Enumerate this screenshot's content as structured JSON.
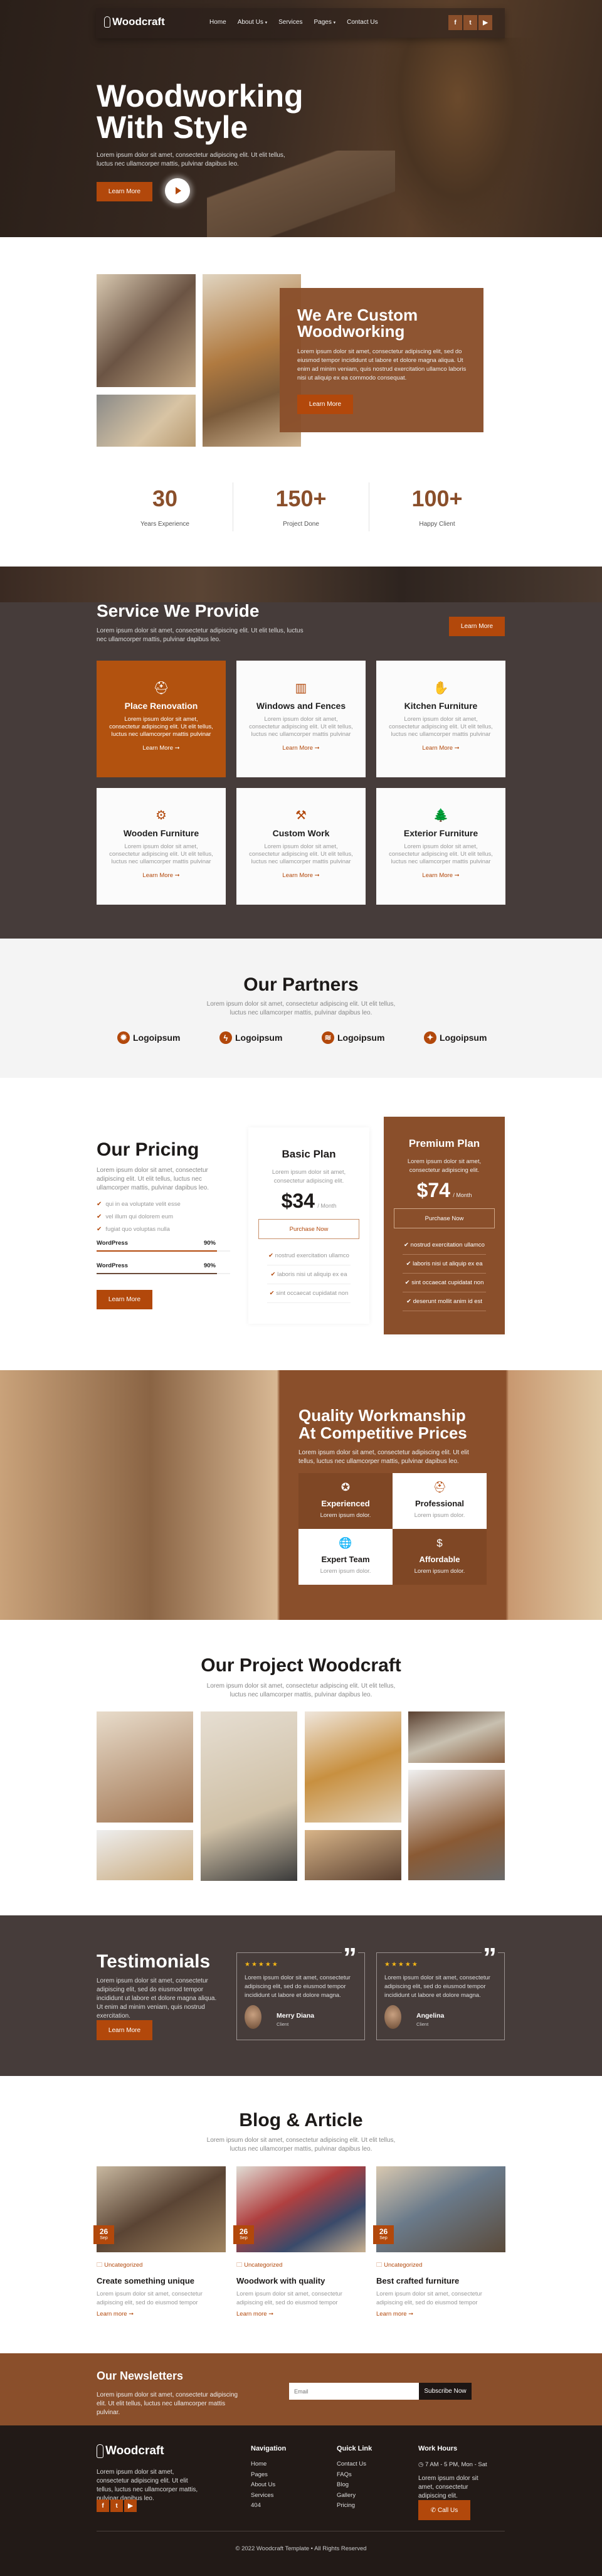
{
  "brand": {
    "name": "Woodcraft",
    "primary": "#b2480b",
    "brown": "#8a4f2b",
    "dark": "#463c3a",
    "footer": "#221a17"
  },
  "nav": {
    "items": [
      {
        "label": "Home"
      },
      {
        "label": "About Us",
        "dropdown": true
      },
      {
        "label": "Services"
      },
      {
        "label": "Pages",
        "dropdown": true
      },
      {
        "label": "Contact Us"
      }
    ],
    "socials": [
      "facebook-icon",
      "twitter-icon",
      "youtube-icon"
    ]
  },
  "hero": {
    "title_line1": "Woodworking",
    "title_line2": "With Style",
    "text": "Lorem ipsum dolor sit amet, consectetur adipiscing elit. Ut elit tellus, luctus nec ullamcorper mattis, pulvinar dapibus leo.",
    "button": "Learn More"
  },
  "about": {
    "title": "We Are Custom Woodworking",
    "text": "Lorem ipsum dolor sit amet, consectetur adipiscing elit, sed do eiusmod tempor incididunt ut labore et dolore magna aliqua. Ut enim ad minim veniam, quis nostrud exercitation ullamco laboris nisi ut aliquip ex ea commodo consequat.",
    "button": "Learn More"
  },
  "stats": [
    {
      "value": "30",
      "label": "Years Experience"
    },
    {
      "value": "150+",
      "label": "Project Done"
    },
    {
      "value": "100+",
      "label": "Happy Client"
    }
  ],
  "services": {
    "title": "Service We Provide",
    "text": "Lorem ipsum dolor sit amet, consectetur adipiscing elit. Ut elit tellus, luctus nec ullamcorper mattis, pulvinar dapibus leo.",
    "button": "Learn More",
    "items": [
      {
        "title": "Place Renovation",
        "icon": "worker-icon",
        "text": "Lorem ipsum dolor sit amet, consectetur adipiscing elit. Ut elit tellus, luctus nec ullamcorper mattis pulvinar",
        "link": "Learn More ➞",
        "active": true
      },
      {
        "title": "Windows and Fences",
        "icon": "planks-icon",
        "text": "Lorem ipsum dolor sit amet, consectetur adipiscing elit. Ut elit tellus, luctus nec ullamcorper mattis pulvinar",
        "link": "Learn More ➞"
      },
      {
        "title": "Kitchen Furniture",
        "icon": "gloves-icon",
        "text": "Lorem ipsum dolor sit amet, consectetur adipiscing elit. Ut elit tellus, luctus nec ullamcorper mattis pulvinar",
        "link": "Learn More ➞"
      },
      {
        "title": "Wooden Furniture",
        "icon": "circular-saw-icon",
        "text": "Lorem ipsum dolor sit amet, consectetur adipiscing elit. Ut elit tellus, luctus nec ullamcorper mattis pulvinar",
        "link": "Learn More ➞"
      },
      {
        "title": "Custom Work",
        "icon": "drill-icon",
        "text": "Lorem ipsum dolor sit amet, consectetur adipiscing elit. Ut elit tellus, luctus nec ullamcorper mattis pulvinar",
        "link": "Learn More ➞"
      },
      {
        "title": "Exterior Furniture",
        "icon": "trees-icon",
        "text": "Lorem ipsum dolor sit amet, consectetur adipiscing elit. Ut elit tellus, luctus nec ullamcorper mattis pulvinar",
        "link": "Learn More ➞"
      }
    ]
  },
  "partners": {
    "title": "Our Partners",
    "text": "Lorem ipsum dolor sit amet, consectetur adipiscing elit. Ut elit tellus, luctus nec ullamcorper mattis, pulvinar dapibus leo.",
    "logos": [
      {
        "label": "Logoipsum",
        "icon": "sun-logo-icon"
      },
      {
        "label": "Logoipsum",
        "icon": "bolt-logo-icon"
      },
      {
        "label": "Logoipsum",
        "icon": "waves-logo-icon"
      },
      {
        "label": "Logoipsum",
        "icon": "star-logo-icon"
      }
    ]
  },
  "pricing": {
    "title": "Our Pricing",
    "text": "Lorem ipsum dolor sit amet, consectetur adipiscing elit. Ut elit tellus, luctus nec ullamcorper mattis, pulvinar dapibus leo.",
    "checks": [
      "qui in ea voluptate velit esse",
      "vel illum qui dolorem eum",
      "fugiat quo voluptas nulla"
    ],
    "skills": [
      {
        "label": "WordPress",
        "value": "90%",
        "percent": 90
      },
      {
        "label": "WordPress",
        "value": "90%",
        "percent": 90
      }
    ],
    "button": "Learn More",
    "plans": [
      {
        "name": "Basic Plan",
        "text": "Lorem ipsum dolor sit amet, consectetur adipiscing elit.",
        "price": "$34",
        "period": "/ Month",
        "button": "Purchase Now",
        "features": [
          "nostrud exercitation ullamco",
          "laboris nisi ut aliquip ex ea",
          "sint occaecat cupidatat non"
        ]
      },
      {
        "name": "Premium Plan",
        "text": "Lorem ipsum dolor sit amet, consectetur adipiscing elit.",
        "price": "$74",
        "period": "/ Month",
        "button": "Purchase Now",
        "features": [
          "nostrud exercitation ullamco",
          "laboris nisi ut aliquip ex ea",
          "sint occaecat cupidatat non",
          "deserunt mollit anim id est"
        ]
      }
    ]
  },
  "quality": {
    "title_line1": "Quality Workmanship",
    "title_line2": "At Competitive Prices",
    "text": "Lorem ipsum dolor sit amet, consectetur adipiscing elit. Ut elit tellus, luctus nec ullamcorper mattis, pulvinar dapibus leo.",
    "items": [
      {
        "title": "Experienced",
        "text": "Lorem ipsum dolor.",
        "icon": "award-icon"
      },
      {
        "title": "Professional",
        "text": "Lorem ipsum dolor.",
        "icon": "worker-icon"
      },
      {
        "title": "Expert Team",
        "text": "Lorem ipsum dolor.",
        "icon": "globe-team-icon"
      },
      {
        "title": "Affordable",
        "text": "Lorem ipsum dolor.",
        "icon": "money-hand-icon"
      }
    ]
  },
  "projects": {
    "title": "Our Project Woodcraft",
    "text": "Lorem ipsum dolor sit amet, consectetur adipiscing elit. Ut elit tellus, luctus nec ullamcorper mattis, pulvinar dapibus leo."
  },
  "testimonials": {
    "title": "Testimonials",
    "text": "Lorem ipsum dolor sit amet, consectetur adipiscing elit, sed do eiusmod tempor incididunt ut labore et dolore magna aliqua. Ut enim ad minim veniam, quis nostrud exercitation.",
    "button": "Learn More",
    "items": [
      {
        "rating": 5,
        "text": "Lorem ipsum dolor sit amet, consectetur adipiscing elit, sed do eiusmod tempor incididunt ut labore et dolore magna.",
        "name": "Merry Diana",
        "role": "Client"
      },
      {
        "rating": 5,
        "text": "Lorem ipsum dolor sit amet, consectetur adipiscing elit, sed do eiusmod tempor incididunt ut labore et dolore magna.",
        "name": "Angelina",
        "role": "Client"
      }
    ]
  },
  "blog": {
    "title": "Blog & Article",
    "text": "Lorem ipsum dolor sit amet, consectetur adipiscing elit. Ut elit tellus, luctus nec ullamcorper mattis, pulvinar dapibus leo.",
    "posts": [
      {
        "day": "26",
        "month": "Sep",
        "category": "Uncategorized",
        "title": "Create something unique",
        "text": "Lorem ipsum dolor sit amet, consectetur adipiscing elit, sed do eiusmod tempor",
        "link": "Learn more ➞"
      },
      {
        "day": "26",
        "month": "Sep",
        "category": "Uncategorized",
        "title": "Woodwork with quality",
        "text": "Lorem ipsum dolor sit amet, consectetur adipiscing elit, sed do eiusmod tempor",
        "link": "Learn more ➞"
      },
      {
        "day": "26",
        "month": "Sep",
        "category": "Uncategorized",
        "title": "Best crafted furniture",
        "text": "Lorem ipsum dolor sit amet, consectetur adipiscing elit, sed do eiusmod tempor",
        "link": "Learn more ➞"
      }
    ]
  },
  "newsletter": {
    "title": "Our Newsletters",
    "text": "Lorem ipsum dolor sit amet, consectetur adipiscing elit. Ut elit tellus, luctus nec ullamcorper mattis pulvinar.",
    "placeholder": "Email",
    "button": "Subscribe Now"
  },
  "footer": {
    "text": "Lorem ipsum dolor sit amet, consectetur adipiscing elit. Ut elit tellus, luctus nec ullamcorper mattis, pulvinar dapibus leo.",
    "navigation_title": "Navigation",
    "navigation": [
      "Home",
      "Pages",
      "About Us",
      "Services",
      "404"
    ],
    "quick_title": "Quick Link",
    "quick": [
      "Contact Us",
      "FAQs",
      "Blog",
      "Gallery",
      "Pricing"
    ],
    "hours_title": "Work Hours",
    "hours": "7 AM - 5 PM, Mon - Sat",
    "hours_text": "Lorem ipsum dolor sit amet, consectetur adipiscing elit.",
    "call": "Call Us",
    "copyright": "© 2022 Woodcraft Template • All Rights Reserved"
  }
}
